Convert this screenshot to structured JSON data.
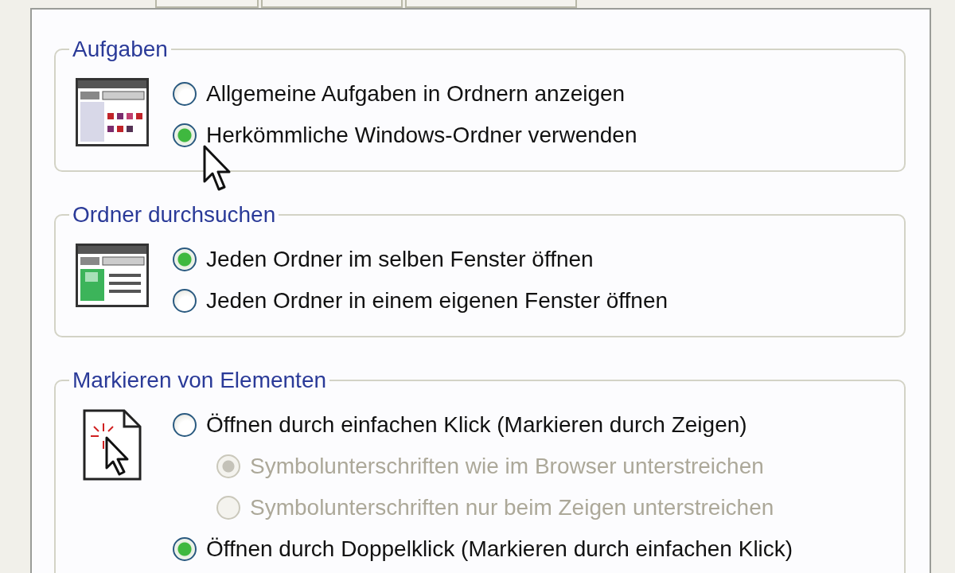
{
  "groups": [
    {
      "title": "Aufgaben",
      "kind": "tasks",
      "options": [
        {
          "label": "Allgemeine Aufgaben in Ordnern anzeigen",
          "selected": false,
          "disabled": false
        },
        {
          "label": "Herkömmliche Windows-Ordner verwenden",
          "selected": true,
          "disabled": false
        }
      ]
    },
    {
      "title": "Ordner durchsuchen",
      "kind": "browse",
      "options": [
        {
          "label": "Jeden Ordner im selben Fenster öffnen",
          "selected": true,
          "disabled": false
        },
        {
          "label": "Jeden Ordner in einem eigenen Fenster öffnen",
          "selected": false,
          "disabled": false
        }
      ]
    },
    {
      "title": "Markieren von Elementen",
      "kind": "click",
      "options": [
        {
          "label": "Öffnen durch einfachen Klick (Markieren durch Zeigen)",
          "selected": false,
          "disabled": false,
          "children": [
            {
              "label": "Symbolunterschriften wie im Browser unterstreichen",
              "selected": true,
              "disabled": true
            },
            {
              "label": "Symbolunterschriften nur beim Zeigen unterstreichen",
              "selected": false,
              "disabled": true
            }
          ]
        },
        {
          "label": "Öffnen durch Doppelklick (Markieren durch einfachen Klick)",
          "selected": true,
          "disabled": false
        }
      ]
    }
  ]
}
